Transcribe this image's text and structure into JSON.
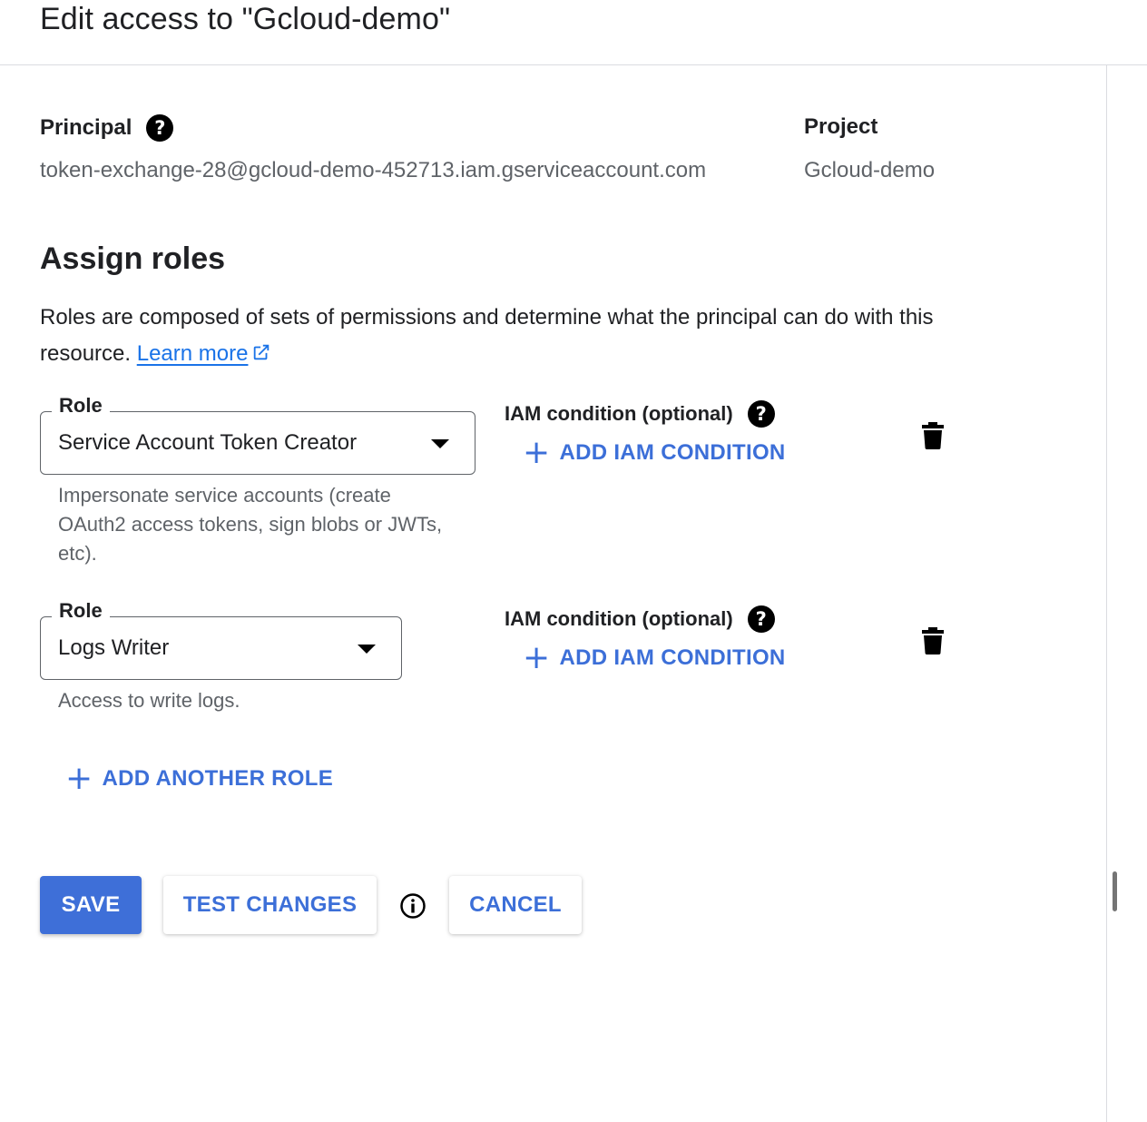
{
  "header": {
    "title": "Edit access to \"Gcloud-demo\""
  },
  "principal": {
    "label": "Principal",
    "value": "token-exchange-28@gcloud-demo-452713.iam.gserviceaccount.com"
  },
  "project": {
    "label": "Project",
    "value": "Gcloud-demo"
  },
  "assign_roles": {
    "title": "Assign roles",
    "description": "Roles are composed of sets of permissions and determine what the principal can do with this resource.",
    "learn_more": "Learn more"
  },
  "roles": [
    {
      "legend": "Role",
      "value": "Service Account Token Creator",
      "hint": "Impersonate service accounts (create OAuth2 access tokens, sign blobs or JWTs, etc).",
      "iam_label": "IAM condition (optional)",
      "add_condition": "ADD IAM CONDITION"
    },
    {
      "legend": "Role",
      "value": "Logs Writer",
      "hint": "Access to write logs.",
      "iam_label": "IAM condition (optional)",
      "add_condition": "ADD IAM CONDITION"
    }
  ],
  "add_another_role": "ADD ANOTHER ROLE",
  "buttons": {
    "save": "SAVE",
    "test_changes": "TEST CHANGES",
    "cancel": "CANCEL"
  },
  "icons": {
    "help": "help-icon",
    "delete": "trash-icon",
    "info": "info-icon",
    "external": "external-link-icon",
    "add": "plus-icon"
  },
  "colors": {
    "accent": "#3e6fd8",
    "link": "#1a73e8",
    "muted_text": "#5f6368"
  }
}
